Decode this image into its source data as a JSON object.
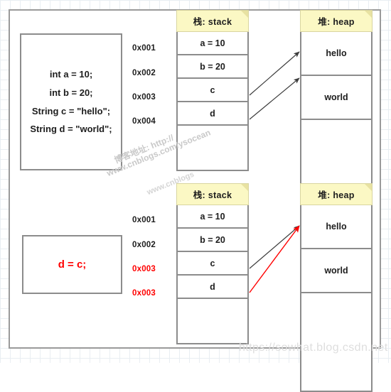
{
  "diagram": {
    "title": "Java stack and heap reference assignment diagram",
    "accent_red": "#ff0000",
    "header_yellow": "#fbf8c4",
    "border_grey": "#8c8c8c"
  },
  "top_section": {
    "code_box": {
      "lines": [
        "int a = 10;",
        "int b = 20;",
        "String c = \"hello\";",
        "String d = \"world\";"
      ]
    },
    "addresses": [
      {
        "text": "0x001",
        "color": "black"
      },
      {
        "text": "0x002",
        "color": "black"
      },
      {
        "text": "0x003",
        "color": "black"
      },
      {
        "text": "0x004",
        "color": "black"
      }
    ],
    "stack": {
      "header": "栈: stack",
      "rows": [
        "a = 10",
        "b = 20",
        "c",
        "d",
        ""
      ]
    },
    "heap": {
      "header": "堆: heap",
      "rows": [
        "hello",
        "world",
        ""
      ]
    },
    "arrows": [
      {
        "from": "stack-row-c",
        "to": "heap-row-hello",
        "color": "#444444"
      },
      {
        "from": "stack-row-d",
        "to": "heap-row-world",
        "color": "#444444"
      }
    ]
  },
  "bottom_section": {
    "code_box": {
      "lines": [
        "d = c;"
      ]
    },
    "addresses": [
      {
        "text": "0x001",
        "color": "black"
      },
      {
        "text": "0x002",
        "color": "black"
      },
      {
        "text": "0x003",
        "color": "red"
      },
      {
        "text": "0x003",
        "color": "red"
      }
    ],
    "stack": {
      "header": "栈: stack",
      "rows": [
        "a = 10",
        "b = 20",
        "c",
        "d",
        ""
      ]
    },
    "heap": {
      "header": "堆: heap",
      "rows": [
        "hello",
        "world",
        ""
      ]
    },
    "arrows": [
      {
        "from": "stack-row-c",
        "to": "heap-row-hello",
        "color": "#444444"
      },
      {
        "from": "stack-row-d",
        "to": "heap-row-hello",
        "color": "#ff0000"
      }
    ]
  },
  "watermarks": {
    "top_line_1": "博客地址: http://",
    "top_line_2": "www.cnblogs.com/ysocean",
    "mid_line_1": "www.cnblogs",
    "bottom": "https://sowhat.blog.csdn.net"
  }
}
